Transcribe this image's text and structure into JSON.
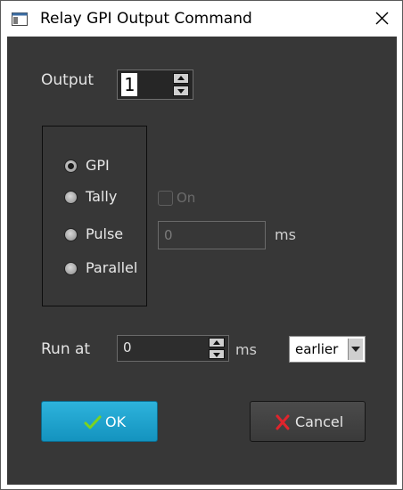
{
  "window": {
    "title": "Relay GPI Output Command",
    "icon": "app-window-icon",
    "close_icon": "close-icon"
  },
  "output": {
    "label": "Output",
    "value": "1"
  },
  "mode": {
    "selected": "GPI",
    "options": [
      {
        "label": "GPI",
        "checked": true
      },
      {
        "label": "Tally",
        "checked": false
      },
      {
        "label": "Pulse",
        "checked": false
      },
      {
        "label": "Parallel",
        "checked": false
      }
    ]
  },
  "tally": {
    "on_label": "On",
    "on_checked": false,
    "enabled": false
  },
  "pulse": {
    "value": "0",
    "unit": "ms",
    "enabled": false
  },
  "run_at": {
    "label": "Run at",
    "value": "0",
    "unit": "ms",
    "timing_selected": "earlier"
  },
  "buttons": {
    "ok_label": "OK",
    "cancel_label": "Cancel"
  },
  "colors": {
    "background": "#373737",
    "ok_button": "#1ea5d1",
    "ok_check": "#7bd320",
    "cancel_x": "#e0242c"
  }
}
